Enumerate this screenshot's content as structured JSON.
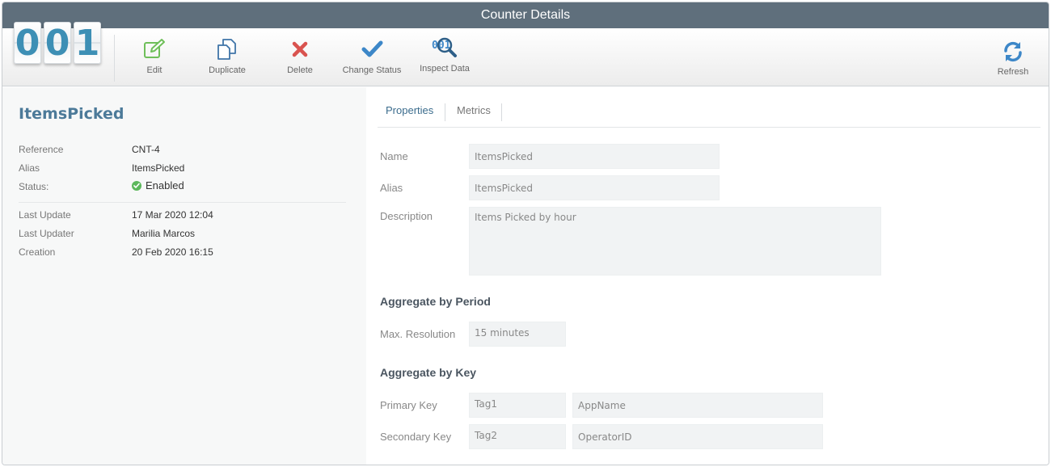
{
  "window": {
    "title": "Counter Details"
  },
  "logo": {
    "digits": [
      "0",
      "0",
      "1"
    ]
  },
  "toolbar": {
    "edit_label": "Edit",
    "duplicate_label": "Duplicate",
    "delete_label": "Delete",
    "change_status_label": "Change Status",
    "inspect_label": "Inspect Data",
    "refresh_label": "Refresh"
  },
  "colors": {
    "titlebar": "#5f6f7c",
    "accent": "#4c7a99",
    "edit_icon": "#6fbf5a",
    "delete_icon": "#d9534f",
    "check_icon": "#3d87c8",
    "status_enabled": "#5cb85c"
  },
  "icons": {
    "edit": "edit-icon",
    "duplicate": "duplicate-icon",
    "delete": "delete-icon",
    "change_status": "checkmark-icon",
    "inspect": "inspect-data-icon",
    "refresh": "refresh-icon",
    "status": "check-circle-icon"
  },
  "summary": {
    "title": "ItemsPicked",
    "reference_label": "Reference",
    "reference_value": "CNT-4",
    "alias_label": "Alias",
    "alias_value": "ItemsPicked",
    "status_label": "Status:",
    "status_value": "Enabled",
    "last_update_label": "Last Update",
    "last_update_value": "17 Mar 2020 12:04",
    "last_updater_label": "Last Updater",
    "last_updater_value": "Marilia Marcos",
    "creation_label": "Creation",
    "creation_value": "20 Feb 2020 16:15"
  },
  "tabs": [
    {
      "label": "Properties",
      "active": true
    },
    {
      "label": "Metrics",
      "active": false
    }
  ],
  "form": {
    "name_label": "Name",
    "name_value": "ItemsPicked",
    "alias_label": "Alias",
    "alias_value": "ItemsPicked",
    "description_label": "Description",
    "description_value": "Items Picked by hour",
    "aggregate_period_heading": "Aggregate by Period",
    "max_resolution_label": "Max. Resolution",
    "max_resolution_value": "15 minutes",
    "aggregate_key_heading": "Aggregate by Key",
    "primary_key_label": "Primary Key",
    "primary_key_tag": "Tag1",
    "primary_key_value": "AppName",
    "secondary_key_label": "Secondary Key",
    "secondary_key_tag": "Tag2",
    "secondary_key_value": "OperatorID"
  }
}
